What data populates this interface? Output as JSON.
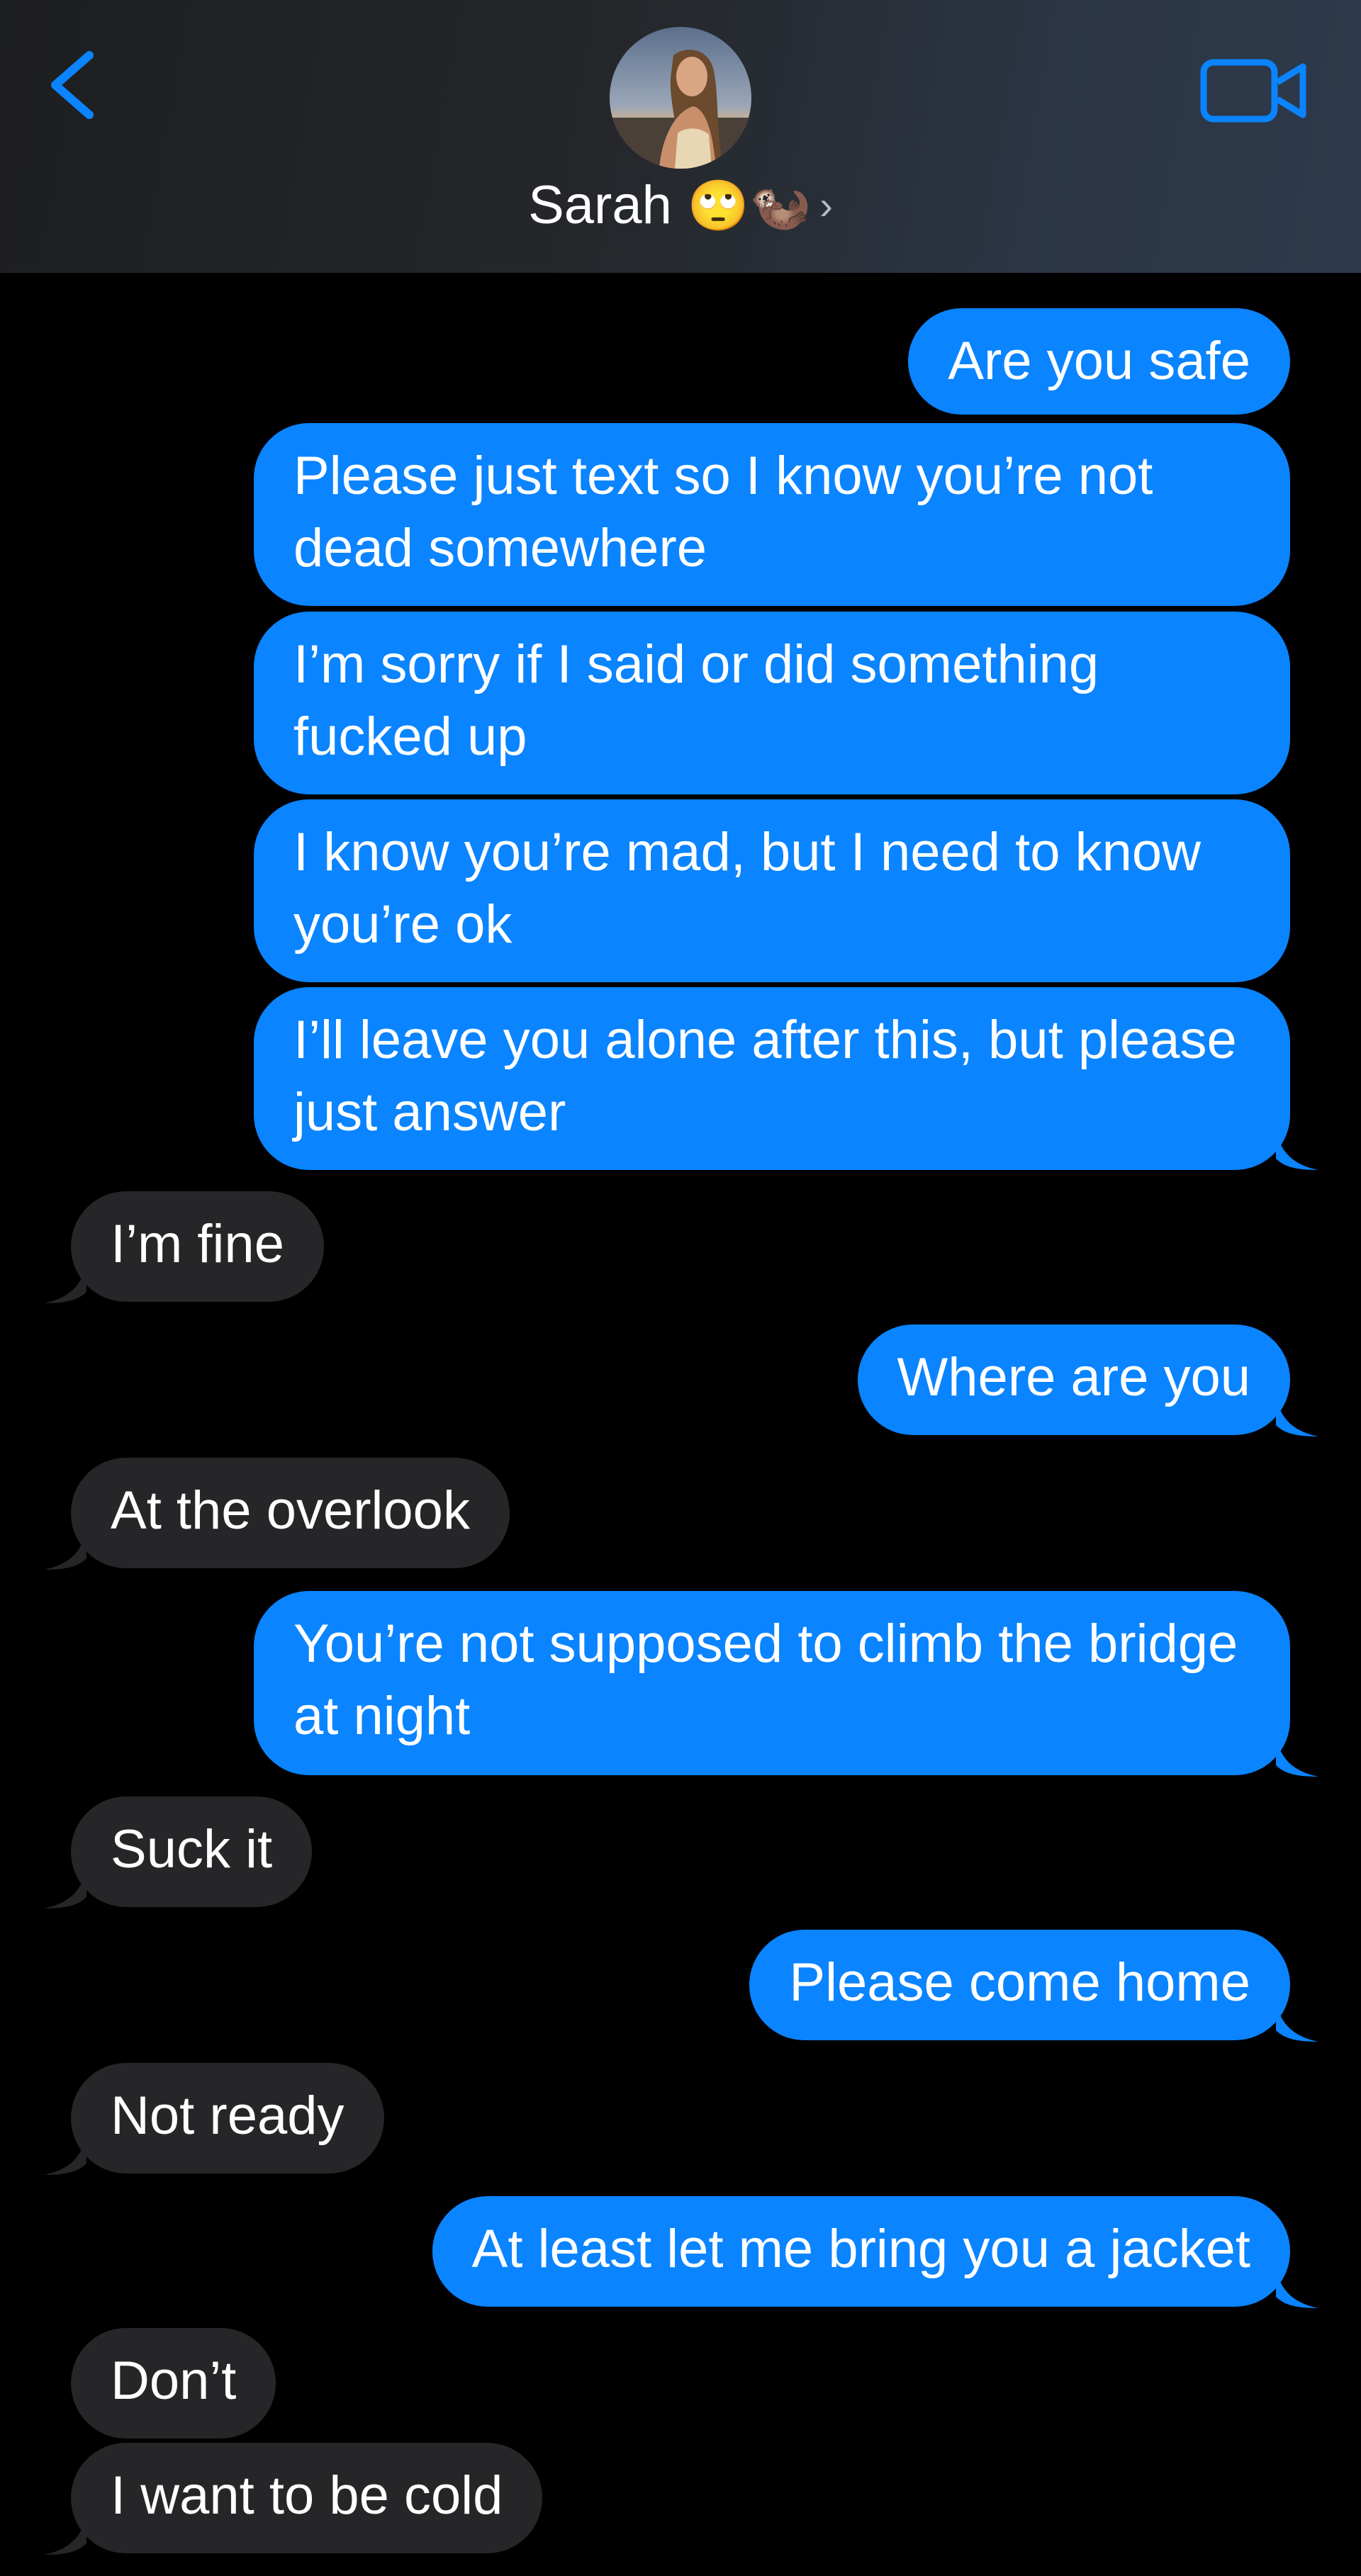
{
  "header": {
    "contact_name": "Sarah",
    "contact_emoji": "🙄🦦",
    "chevron": "›",
    "back_icon": "chevron-left-icon",
    "video_icon": "video-camera-icon",
    "accent_color": "#0a84ff"
  },
  "messages": [
    {
      "sender": "me",
      "text": "Are you safe"
    },
    {
      "sender": "me",
      "text": "Please just text so I know you’re not dead somewhere"
    },
    {
      "sender": "me",
      "text": "I’m sorry if I said or did something fucked up"
    },
    {
      "sender": "me",
      "text": "I know you’re mad, but I need to know you’re ok"
    },
    {
      "sender": "me",
      "text": "I’ll leave you alone after this, but please just answer"
    },
    {
      "sender": "them",
      "text": "I’m fine"
    },
    {
      "sender": "me",
      "text": "Where are you"
    },
    {
      "sender": "them",
      "text": "At the overlook"
    },
    {
      "sender": "me",
      "text": "You’re not supposed to climb the bridge at night"
    },
    {
      "sender": "them",
      "text": "Suck it"
    },
    {
      "sender": "me",
      "text": "Please come home"
    },
    {
      "sender": "them",
      "text": "Not ready"
    },
    {
      "sender": "me",
      "text": "At least let me bring you a jacket"
    },
    {
      "sender": "them",
      "text": "Don’t"
    },
    {
      "sender": "them",
      "text": "I want to be cold"
    }
  ],
  "colors": {
    "sent_bubble": "#0a84ff",
    "received_bubble": "#262629",
    "background": "#000000"
  }
}
